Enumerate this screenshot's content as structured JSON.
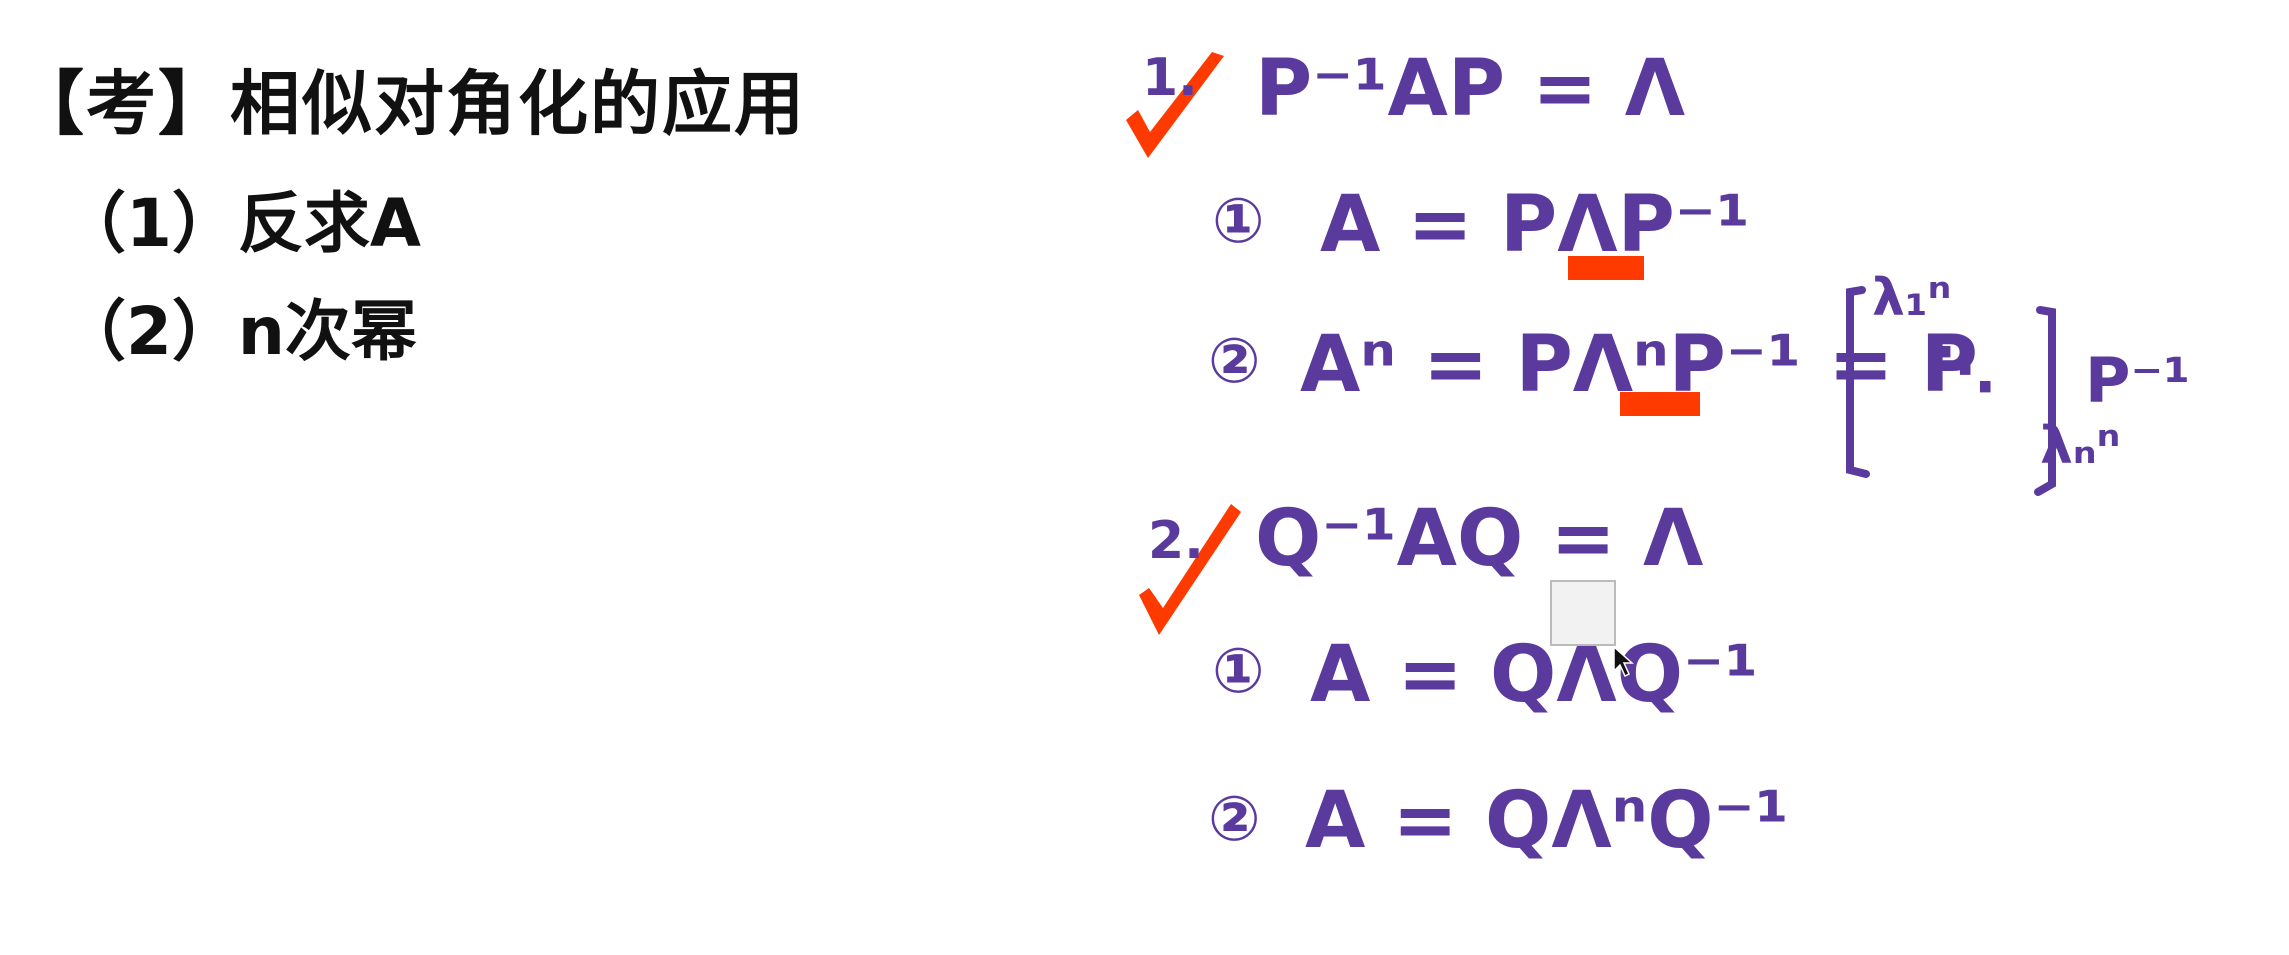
{
  "slide": {
    "title": "【考】相似对角化的应用",
    "items": [
      "（1）反求A",
      "（2）n次幂"
    ]
  },
  "notes": {
    "colors": {
      "ink": "#5b3a9e",
      "highlight": "#ff3a00"
    },
    "section1": {
      "number": "1.",
      "equation": "P⁻¹AP = Λ",
      "step1": {
        "marker": "①",
        "text": "A = PΛP⁻¹"
      },
      "step2": {
        "marker": "②",
        "text": "Aⁿ = PΛⁿP⁻¹ = P",
        "matrix_top": "λ₁ⁿ",
        "matrix_dots": "⋱",
        "matrix_bottom": "λₙⁿ",
        "after_matrix": "P⁻¹"
      }
    },
    "section2": {
      "number": "2.",
      "equation": "Q⁻¹AQ = Λ",
      "step1": {
        "marker": "①",
        "text": "A = QΛQ⁻¹"
      },
      "step2": {
        "marker": "②",
        "text": "A = QΛⁿQ⁻¹"
      }
    }
  }
}
